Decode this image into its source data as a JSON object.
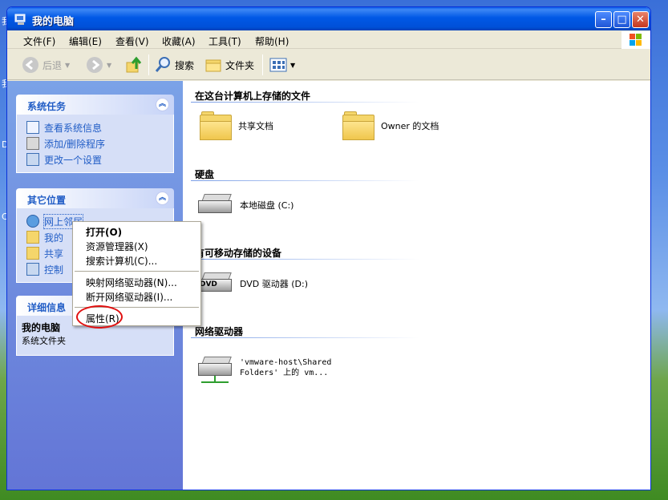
{
  "window": {
    "title": "我的电脑"
  },
  "desktop": {
    "labels": [
      "我",
      "我",
      "D",
      "C"
    ]
  },
  "menubar": [
    "文件(F)",
    "编辑(E)",
    "查看(V)",
    "收藏(A)",
    "工具(T)",
    "帮助(H)"
  ],
  "toolbar": {
    "back": "后退",
    "search": "搜索",
    "folders": "文件夹"
  },
  "left_panels": {
    "system_tasks": {
      "title": "系统任务",
      "items": [
        "查看系统信息",
        "添加/删除程序",
        "更改一个设置"
      ]
    },
    "other_places": {
      "title": "其它位置",
      "items": [
        "网上邻居",
        "我的",
        "共享",
        "控制"
      ]
    },
    "details": {
      "title": "详细信息",
      "name": "我的电脑",
      "type": "系统文件夹"
    }
  },
  "groups": [
    {
      "title": "在这台计算机上存储的文件"
    },
    {
      "title": "硬盘"
    },
    {
      "title": "有可移动存储的设备"
    },
    {
      "title": "网络驱动器"
    }
  ],
  "items": {
    "shared_docs": "共享文档",
    "owner_docs": "Owner 的文档",
    "local_disk": "本地磁盘 (C:)",
    "dvd": "DVD 驱动器 (D:)",
    "dvd_label": "DVD",
    "net_line1": "'vmware-host\\Shared",
    "net_line2": "Folders' 上的 vm..."
  },
  "context_menu": {
    "open": "打开(O)",
    "explore": "资源管理器(X)",
    "search_computers": "搜索计算机(C)...",
    "map_drive": "映射网络驱动器(N)...",
    "disconnect_drive": "断开网络驱动器(I)...",
    "properties": "属性(R)"
  },
  "colors": {
    "title_bar": "#0058e6",
    "panel_link": "#215dc6",
    "annotation_circle": "#e01010"
  }
}
